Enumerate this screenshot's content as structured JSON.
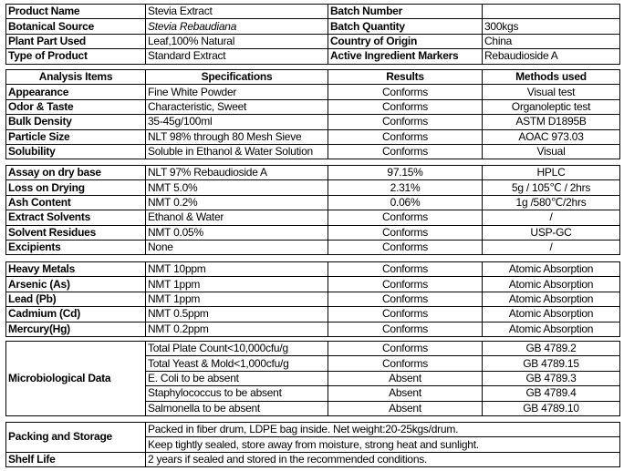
{
  "product_info": [
    [
      "Product Name",
      "Stevia Extract",
      "Batch Number",
      ""
    ],
    [
      "Botanical Source",
      "Stevia Rebaudiana",
      "Batch Quantity",
      "300kgs"
    ],
    [
      "Plant Part Used",
      "Leaf,100% Natural",
      "Country of Origin",
      "China"
    ],
    [
      "Type of Product",
      "Standard Extract",
      "Active Ingredient Markers",
      "Rebaudioside A"
    ]
  ],
  "analysis_header": [
    "Analysis Items",
    "Specifications",
    "Results",
    "Methods used"
  ],
  "physical": [
    [
      "Appearance",
      "Fine White Powder",
      "Conforms",
      "Visual test"
    ],
    [
      "Odor & Taste",
      "Characteristic, Sweet",
      "Conforms",
      "Organoleptic test"
    ],
    [
      "Bulk Density",
      "35-45g/100ml",
      "Conforms",
      "ASTM D1895B"
    ],
    [
      "Particle Size",
      "NLT 98% through 80 Mesh Sieve",
      "Conforms",
      "AOAC 973.03"
    ],
    [
      "Solubility",
      "Soluble in Ethanol & Water Solution",
      "Conforms",
      "Visual"
    ]
  ],
  "chemical": [
    [
      "Assay on dry base",
      "NLT 97% Rebaudioside A",
      "97.15%",
      "HPLC"
    ],
    [
      "Loss on Drying",
      "NMT 5.0%",
      "2.31%",
      "5g / 105℃ / 2hrs"
    ],
    [
      "Ash Content",
      "NMT 0.2%",
      "0.06%",
      "1g /580℃/2hrs"
    ],
    [
      "Extract Solvents",
      "Ethanol & Water",
      "Conforms",
      "/"
    ],
    [
      "Solvent Residues",
      "NMT 0.05%",
      "Conforms",
      "USP-GC"
    ],
    [
      "Excipients",
      "None",
      "Conforms",
      "/"
    ]
  ],
  "metals": [
    [
      "Heavy Metals",
      "NMT 10ppm",
      "Conforms",
      "Atomic Absorption"
    ],
    [
      "Arsenic (As)",
      "NMT 1ppm",
      "Conforms",
      "Atomic Absorption"
    ],
    [
      "Lead (Pb)",
      "NMT 1ppm",
      "Conforms",
      "Atomic Absorption"
    ],
    [
      "Cadmium (Cd)",
      "NMT 0.5ppm",
      "Conforms",
      "Atomic Absorption"
    ],
    [
      "Mercury(Hg)",
      "NMT 0.2ppm",
      "Conforms",
      "Atomic Absorption"
    ]
  ],
  "micro": {
    "label": "Microbiological Data",
    "rows": [
      [
        "Total Plate Count<10,000cfu/g",
        "Conforms",
        "GB 4789.2"
      ],
      [
        "Total Yeast & Mold<1,000cfu/g",
        "Conforms",
        "GB 4789.15"
      ],
      [
        "E. Coli to be absent",
        "Absent",
        "GB 4789.3"
      ],
      [
        "Staphylococcus to be absent",
        "Absent",
        "GB 4789.4"
      ],
      [
        "Salmonella to be absent",
        "Absent",
        "GB 4789.10"
      ]
    ]
  },
  "packing": {
    "label": "Packing and Storage",
    "lines": [
      "Packed in fiber drum, LDPE bag inside. Net weight:20-25kgs/drum.",
      "Keep tightly sealed, store away from moisture, strong heat and sunlight."
    ]
  },
  "shelf_life": {
    "label": "Shelf Life",
    "value": "2 years if sealed and stored in the recommended conditions."
  }
}
